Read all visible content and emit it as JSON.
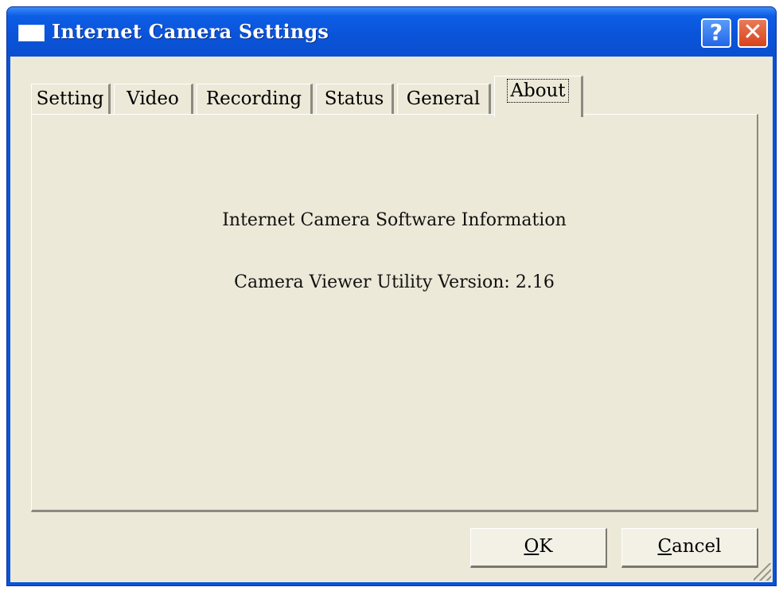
{
  "window": {
    "title": "Internet Camera Settings",
    "help_glyph": "?",
    "close_glyph": "✕",
    "accent_color": "#0a53d8"
  },
  "tabs": [
    {
      "label": "Setting",
      "active": false
    },
    {
      "label": "Video",
      "active": false
    },
    {
      "label": "Recording",
      "active": false
    },
    {
      "label": "Status",
      "active": false
    },
    {
      "label": "General",
      "active": false
    },
    {
      "label": "About",
      "active": true
    }
  ],
  "about": {
    "heading": "Internet Camera Software Information",
    "version_line": "Camera Viewer Utility Version: 2.16"
  },
  "buttons": {
    "ok_accel": "O",
    "ok_rest": "K",
    "cancel_accel": "C",
    "cancel_rest": "ancel"
  }
}
